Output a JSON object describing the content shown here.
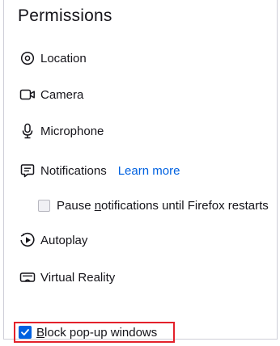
{
  "section": {
    "title": "Permissions"
  },
  "items": [
    {
      "label": "Location",
      "icon": "location-icon"
    },
    {
      "label": "Camera",
      "icon": "camera-icon"
    },
    {
      "label": "Microphone",
      "icon": "microphone-icon"
    },
    {
      "label": "Notifications",
      "icon": "notifications-icon",
      "link": "Learn more"
    },
    {
      "label": "Autoplay",
      "icon": "autoplay-icon"
    },
    {
      "label": "Virtual Reality",
      "icon": "virtual-reality-icon"
    }
  ],
  "pause_notifications": {
    "label_prefix": "Pause ",
    "label_accesskey": "n",
    "label_rest": "otifications until Firefox restarts",
    "checked": false
  },
  "block_popups": {
    "label_accesskey": "B",
    "label_rest": "lock pop-up windows",
    "checked": true
  },
  "colors": {
    "link": "#0061e0",
    "highlight": "#e3212b",
    "checkbox_checked": "#0061e0"
  }
}
